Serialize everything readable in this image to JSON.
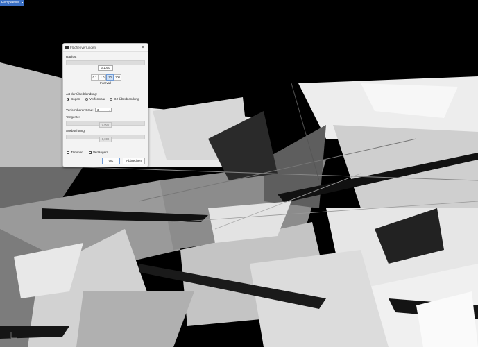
{
  "viewport": {
    "tab_label": "Perspektive",
    "tab_arrow": "▾",
    "axis_label": "y x"
  },
  "dialog": {
    "title": "Flächenverrunden",
    "close": "✕",
    "radius_label": "Radius:",
    "radius_value": "0,1000",
    "radius_steps": [
      "0.1",
      "1.0",
      "10",
      "100"
    ],
    "radius_step_active": "10",
    "interval_label": "Intervall",
    "transition_label": "Art der Überblendung:",
    "transition_options": [
      {
        "label": "Bogen",
        "selected": true
      },
      {
        "label": "Verformbar",
        "selected": false
      },
      {
        "label": "G2-Überblendung",
        "selected": false
      }
    ],
    "degree_label": "Verformbarer Grad:",
    "degree_value": "3",
    "tangent_label": "Tangente:",
    "tangent_value": "0,000",
    "bulge_label": "Ausbuchtung:",
    "bulge_value": "0,000",
    "trim_label": "Trimmen",
    "trim_checked": true,
    "extend_label": "Verlängern",
    "extend_checked": true,
    "ok_label": "OK",
    "cancel_label": "Abbrechen"
  },
  "colors": {
    "dialog_bg": "#f3f3f3",
    "tab_bg": "#3a6fc4",
    "viewport_bg": "#000000",
    "accent": "#6e9ad6"
  }
}
